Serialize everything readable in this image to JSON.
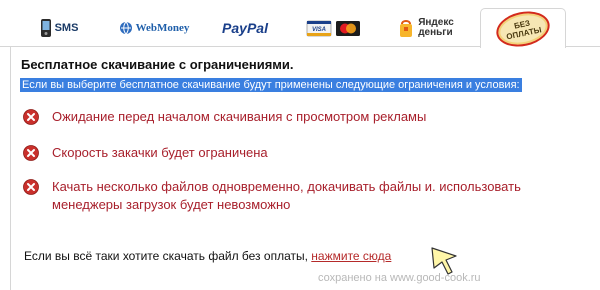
{
  "tabs": {
    "sms_label": "SMS",
    "webmoney_label": "WebMoney",
    "paypal_label": "PayPal",
    "cards_visa_label": "VISA",
    "yandex_label_line1": "Яндекс",
    "yandex_label_line2": "деньги",
    "free_label_line1": "БЕЗ",
    "free_label_line2": "ОПЛАТЫ"
  },
  "panel": {
    "title": "Бесплатное скачивание с ограничениями.",
    "subtitle": "Если вы выберите бесплатное скачивание будут применены следующие ограничения и условия:",
    "conditions": [
      {
        "text": "Ожидание перед началом скачивания с просмотром рекламы"
      },
      {
        "text": "Скорость закачки будет ограничена"
      },
      {
        "text": "Качать несколько файлов одновременно, докачивать файлы и. использовать менеджеры загрузок будет невозможно"
      }
    ],
    "footer_text": "Если вы всё таки хотите скачать файл без оплаты,",
    "footer_link": "нажмите сюда"
  },
  "watermark": "сохранено на www.good-cook.ru",
  "colors": {
    "condition_text": "#a8202c",
    "highlight_bg": "#3a7fe0",
    "link": "#b52a2a",
    "error_icon": "#c9302c"
  },
  "icons": {
    "condition_icon": "error-x-icon",
    "sms_icon": "phone-icon",
    "webmoney_icon": "webmoney-globe-icon",
    "cards_icon": "credit-cards-icon",
    "yandex_icon": "yandex-money-icon",
    "free_icon": "free-seal-icon"
  }
}
